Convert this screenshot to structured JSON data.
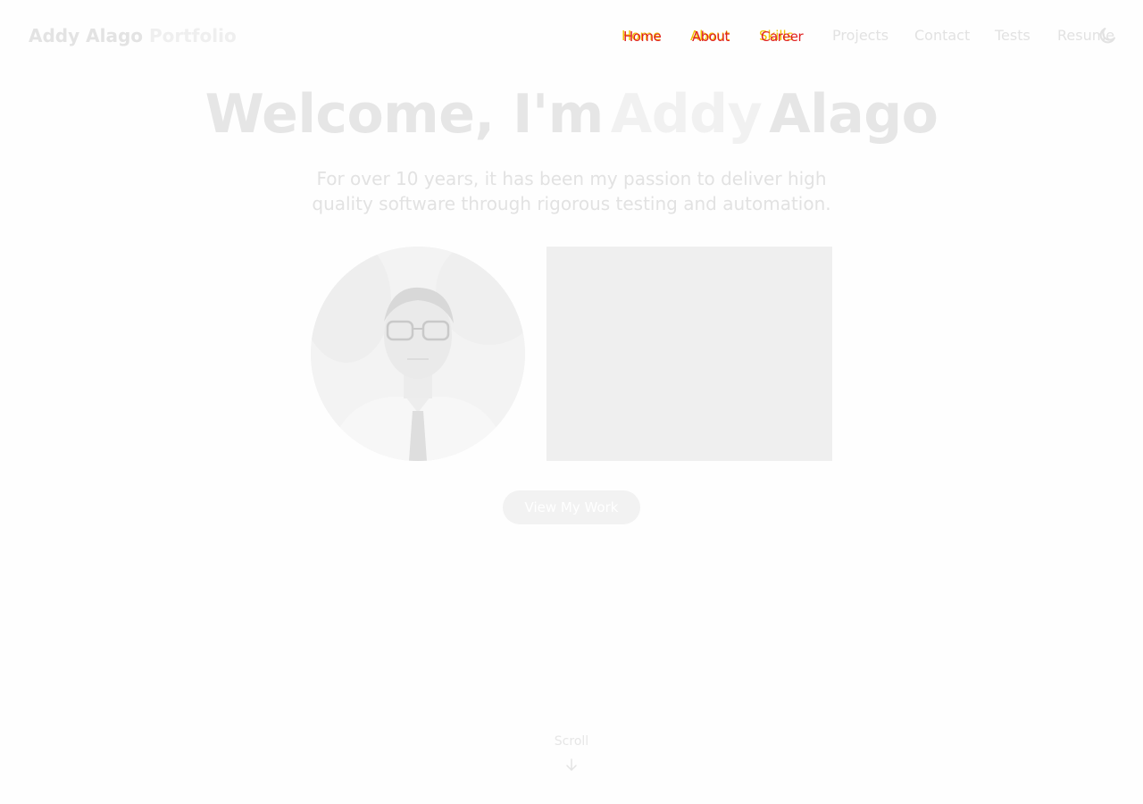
{
  "brand": {
    "name": "Addy Alago",
    "suffix": "Portfolio"
  },
  "nav": {
    "highlighted": [
      {
        "label": "Home",
        "overlay": "Home"
      },
      {
        "label": "About",
        "overlay": "About"
      },
      {
        "label": "Skills",
        "overlay": "Career"
      }
    ],
    "links": [
      "Projects",
      "Contact",
      "Tests",
      "Resume"
    ],
    "theme_icon": "moon-icon"
  },
  "hero": {
    "title_prefix": "Welcome, I'm",
    "title_highlight": "Addy",
    "title_suffix": "Alago",
    "subtitle": "For over 10 years, it has been my passion to deliver high quality software through rigorous testing and automation.",
    "cta_label": "View My Work"
  },
  "scroll": {
    "label": "Scroll",
    "icon": "arrow-down-icon"
  },
  "colors": {
    "background": "#fefefe",
    "text_faded": "#e3e3e3",
    "glitch_yellow": "#f2c200",
    "glitch_red": "#e02020"
  }
}
